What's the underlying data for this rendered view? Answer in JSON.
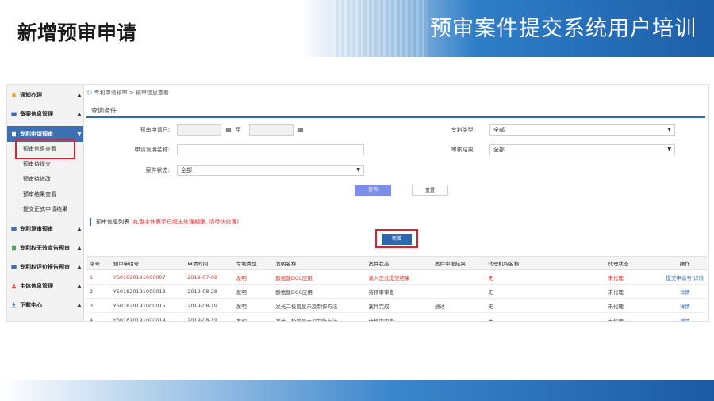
{
  "slide": {
    "title": "新增预审申请",
    "banner_title": "预审案件提交系统用户培训"
  },
  "breadcrumb": "专利申请预审  >  预审信息查看",
  "sidebar": {
    "items": [
      {
        "label": "通知办理",
        "chevron": "▲"
      },
      {
        "label": "备案信息管理",
        "chevron": "▲"
      },
      {
        "label": "专利申请预审",
        "chevron": "▼"
      },
      {
        "label": "专利复审预审",
        "chevron": "▲"
      },
      {
        "label": "专利权无效宣告预审",
        "chevron": "▲"
      },
      {
        "label": "专利权评价报告预审",
        "chevron": "▲"
      },
      {
        "label": "主体信息管理",
        "chevron": "▲"
      },
      {
        "label": "下载中心",
        "chevron": "▲"
      }
    ],
    "subitems": [
      "预审信息查看",
      "预审待提交",
      "预审待修改",
      "预审结果查看",
      "提交正式申请结果"
    ]
  },
  "query": {
    "section_title": "查询条件",
    "date_label": "预审申请日:",
    "date_sep": "至",
    "name_label": "申请发明名称:",
    "status_label": "案件状态:",
    "status_value": "全部",
    "type_label": "专利类型:",
    "type_value": "全部",
    "result_label": "审核结果:",
    "result_value": "全部",
    "query_button": "查询",
    "reset_button": "重置"
  },
  "list": {
    "title": "预审信息列表",
    "warning": "(红色字体表示已超出处理期限, 请尽快处理)",
    "new_button": "新增",
    "columns": [
      "序号",
      "预审申请号",
      "申请时间",
      "专利类型",
      "发明名称",
      "案件状态",
      "案件审批结果",
      "代理机构名称",
      "代理状态",
      "操作"
    ],
    "rows": [
      {
        "no": "1",
        "app_no": "YS01820191000007",
        "date": "2019-07-08",
        "type": "发明",
        "name": "酿氨酸DCC应用",
        "status": "录入正式提交结果",
        "result": "",
        "agency": "无",
        "agent_status": "未代理",
        "op1": "提交申请号",
        "op2": "详情",
        "red": true
      },
      {
        "no": "2",
        "app_no": "YS01820191000018",
        "date": "2019-08-28",
        "type": "发明",
        "name": "酿氨酸DCC应用",
        "status": "待预审审查",
        "result": "",
        "agency": "无",
        "agent_status": "未代理",
        "op1": "",
        "op2": "详情",
        "red": false
      },
      {
        "no": "3",
        "app_no": "YS01820191000015",
        "date": "2019-08-19",
        "type": "发明",
        "name": "发光二极管显示及制作方法",
        "status": "案件完成",
        "result": "通过",
        "agency": "无",
        "agent_status": "未代理",
        "op1": "",
        "op2": "详情",
        "red": false
      },
      {
        "no": "4",
        "app_no": "YS01820191000014",
        "date": "2019-08-19",
        "type": "发明",
        "name": "发光二极管显示及制作方法",
        "status": "待预审审查",
        "result": "",
        "agency": "无",
        "agent_status": "未代理",
        "op1": "",
        "op2": "详情",
        "red": false
      }
    ]
  },
  "colors": {
    "accent": "#2e6db4",
    "highlight": "#e0202a",
    "overdue": "#d8342c"
  }
}
